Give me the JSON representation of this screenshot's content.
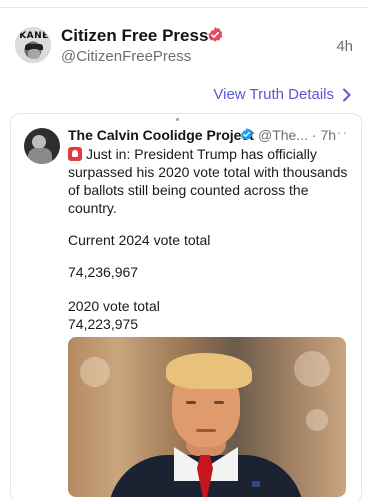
{
  "post": {
    "author_name": "Citizen Free Press",
    "author_handle": "@CitizenFreePress",
    "avatar_text": "KANE",
    "time": "4h",
    "verified_icon": "verified-badge-icon",
    "accent_color": "#e5485c"
  },
  "link": {
    "label": "View Truth Details",
    "icon": "chevron-right-icon",
    "color": "#5a58d6"
  },
  "quote": {
    "author_name": "The Calvin Coolidge Project",
    "handle": "@The...",
    "separator": "·",
    "time": "7h",
    "more_label": "···",
    "text": "Just in: President Trump has officially surpassed his 2020 vote total with thousands of ballots still being counted across the country.",
    "alert_icon": "siren-icon",
    "current_label": "Current 2024 vote total",
    "current_value": "74,236,967",
    "prev_label": "2020 vote total",
    "prev_value": "74,223,975",
    "verify_color": "#1d9bf0"
  }
}
